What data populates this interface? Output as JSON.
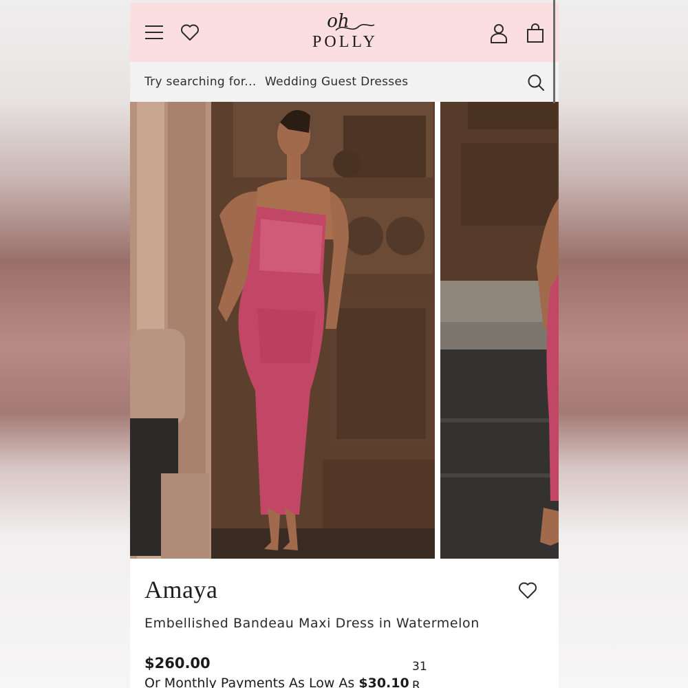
{
  "header": {
    "logo_top": "oh",
    "logo_bottom": "POLLY",
    "menu_icon": "hamburger-menu-icon",
    "wishlist_icon": "heart-icon",
    "account_icon": "user-icon",
    "bag_icon": "shopping-bag-icon",
    "background": "#fbdfe0"
  },
  "search": {
    "prompt": "Try searching for...",
    "suggestion": "Wedding Guest Dresses",
    "icon": "search-icon"
  },
  "gallery": {
    "images": [
      "model wearing dress, front view",
      "model wearing dress, side view"
    ]
  },
  "product": {
    "name": "Amaya",
    "description": "Embellished Bandeau Maxi Dress in Watermelon",
    "price": "$260.00",
    "installments_prefix": "Or Monthly Payments As Low As",
    "installments_amount": "$30.10",
    "side_text_1": "31",
    "side_text_2": "R"
  }
}
